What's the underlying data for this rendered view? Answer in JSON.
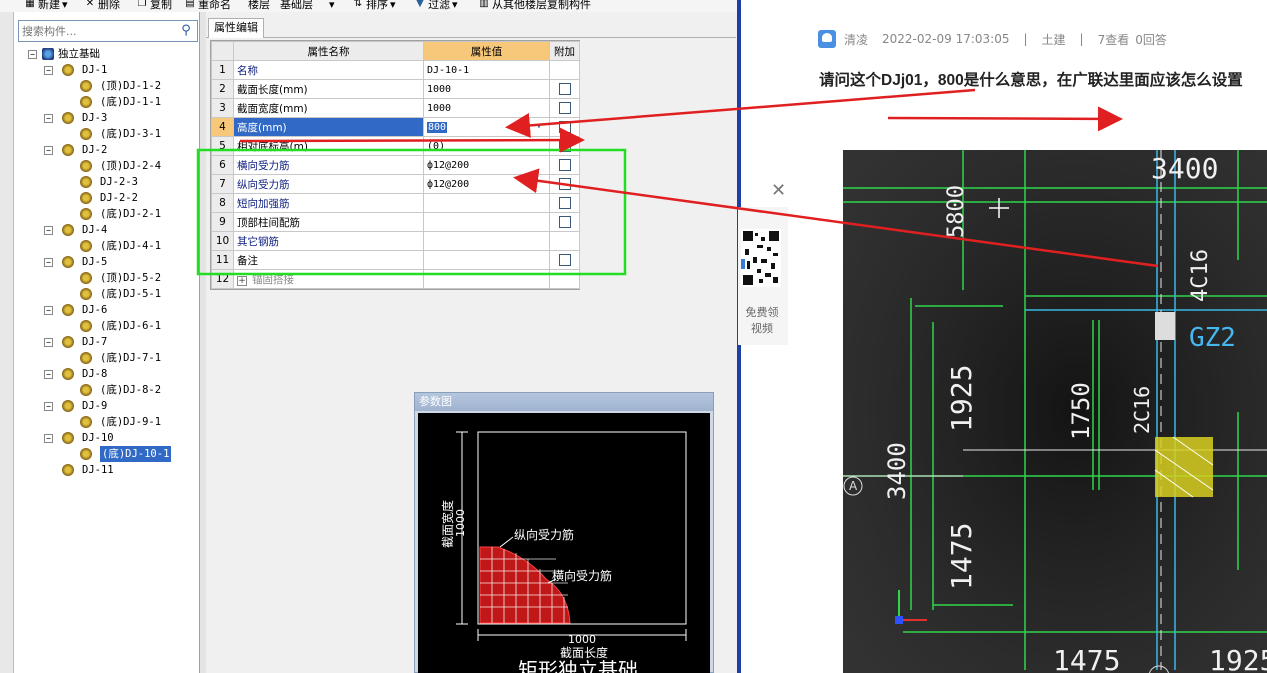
{
  "toolbar": {
    "new_label": "新建",
    "delete_label": "删除",
    "copy_label": "复制",
    "rename_label": "重命名",
    "floor_label": "楼层",
    "floor_value": "基础层",
    "sort_label": "排序",
    "filter_label": "过滤",
    "copy_from_floor_label": "从其他楼层复制构件"
  },
  "search": {
    "placeholder": "搜索构件..."
  },
  "tree": {
    "root": "独立基础",
    "items": [
      {
        "level": 1,
        "label": "DJ-1",
        "expanded": true
      },
      {
        "level": 2,
        "label": "(顶)DJ-1-2"
      },
      {
        "level": 2,
        "label": "(底)DJ-1-1"
      },
      {
        "level": 1,
        "label": "DJ-3",
        "expanded": true
      },
      {
        "level": 2,
        "label": "(底)DJ-3-1"
      },
      {
        "level": 1,
        "label": "DJ-2",
        "expanded": true
      },
      {
        "level": 2,
        "label": "(顶)DJ-2-4"
      },
      {
        "level": 2,
        "label": "DJ-2-3"
      },
      {
        "level": 2,
        "label": "DJ-2-2"
      },
      {
        "level": 2,
        "label": "(底)DJ-2-1"
      },
      {
        "level": 1,
        "label": "DJ-4",
        "expanded": true
      },
      {
        "level": 2,
        "label": "(底)DJ-4-1"
      },
      {
        "level": 1,
        "label": "DJ-5",
        "expanded": true
      },
      {
        "level": 2,
        "label": "(顶)DJ-5-2"
      },
      {
        "level": 2,
        "label": "(底)DJ-5-1"
      },
      {
        "level": 1,
        "label": "DJ-6",
        "expanded": true
      },
      {
        "level": 2,
        "label": "(底)DJ-6-1"
      },
      {
        "level": 1,
        "label": "DJ-7",
        "expanded": true
      },
      {
        "level": 2,
        "label": "(底)DJ-7-1"
      },
      {
        "level": 1,
        "label": "DJ-8",
        "expanded": true
      },
      {
        "level": 2,
        "label": "(底)DJ-8-2"
      },
      {
        "level": 1,
        "label": "DJ-9",
        "expanded": true
      },
      {
        "level": 2,
        "label": "(底)DJ-9-1"
      },
      {
        "level": 1,
        "label": "DJ-10",
        "expanded": true
      },
      {
        "level": 2,
        "label": "(底)DJ-10-1",
        "selected": true
      },
      {
        "level": 1,
        "label": "DJ-11",
        "expanded": false
      }
    ]
  },
  "tab": {
    "label": "属性编辑"
  },
  "grid": {
    "headers": {
      "name": "属性名称",
      "value": "属性值",
      "extra": "附加"
    },
    "rows": [
      {
        "n": "1",
        "name": "名称",
        "value": "DJ-10-1",
        "check": false,
        "style": "blue"
      },
      {
        "n": "2",
        "name": "截面长度(mm)",
        "value": "1000",
        "check": true,
        "style": "plain"
      },
      {
        "n": "3",
        "name": "截面宽度(mm)",
        "value": "1000",
        "check": true,
        "style": "plain"
      },
      {
        "n": "4",
        "name": "高度(mm)",
        "value": "800",
        "check": true,
        "style": "active"
      },
      {
        "n": "5",
        "name": "相对底标高(m)",
        "value": "(0)",
        "check": true,
        "style": "plain"
      },
      {
        "n": "6",
        "name": "横向受力筋",
        "value": "ф12@200",
        "check": true,
        "style": "blue"
      },
      {
        "n": "7",
        "name": "纵向受力筋",
        "value": "ф12@200",
        "check": true,
        "style": "blue"
      },
      {
        "n": "8",
        "name": "短向加强筋",
        "value": "",
        "check": true,
        "style": "blue"
      },
      {
        "n": "9",
        "name": "顶部柱间配筋",
        "value": "",
        "check": true,
        "style": "plain"
      },
      {
        "n": "10",
        "name": "其它钢筋",
        "value": "",
        "check": false,
        "style": "blue"
      },
      {
        "n": "11",
        "name": "备注",
        "value": "",
        "check": true,
        "style": "plain"
      },
      {
        "n": "12",
        "name": "锚固搭接",
        "value": "",
        "check": false,
        "style": "gray",
        "expander": "+"
      }
    ]
  },
  "diagram": {
    "title": "参数图",
    "label_width": "截面宽度",
    "label_width_val": "1000",
    "label_long": "纵向受力筋",
    "label_trans": "横向受力筋",
    "label_length_val": "1000",
    "label_length": "截面长度",
    "caption": "矩形独立基础"
  },
  "qr_card": {
    "line1": "免费领",
    "line2": "视频"
  },
  "article": {
    "author": "清凌",
    "datetime": "2022-02-09 17:03:05",
    "category": "土建",
    "views": "7查看",
    "answers": "0回答",
    "question": "请问这个DJj01，800是什么意思，在广联达里面应该怎么设置"
  },
  "photo": {
    "dims": [
      "3400",
      "5800",
      "4C16",
      "GZ2",
      "1925",
      "1750",
      "2C16",
      "3400",
      "1475",
      "1475",
      "1925"
    ],
    "axis_label": "A"
  },
  "colors": {
    "highlight_green": "#22dd22",
    "arrow_red": "#e02020",
    "header_orange": "#f7c77a",
    "selection_blue": "#3169c6"
  }
}
